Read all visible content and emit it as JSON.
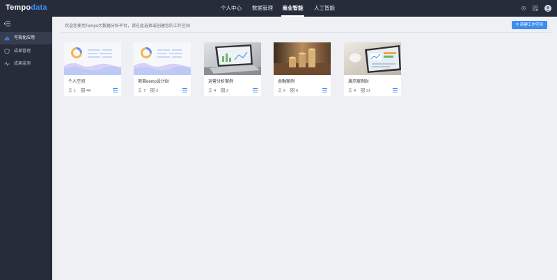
{
  "app": {
    "logo_part1": "Tempo",
    "logo_part2": "data",
    "brand_color": "#3d8cf0",
    "topbar_color": "#262c3a"
  },
  "nav": {
    "items": [
      {
        "label": "个人中心",
        "active": false
      },
      {
        "label": "数据管理",
        "active": false
      },
      {
        "label": "商业智能",
        "active": true
      },
      {
        "label": "人工智能",
        "active": false
      }
    ]
  },
  "header_icons": [
    "settings-icon",
    "qr-code-icon",
    "user-avatar"
  ],
  "sidebar": {
    "items": [
      {
        "label": "可视化应用",
        "icon": "bar-chart-icon",
        "active": true
      },
      {
        "label": "成果管理",
        "icon": "shield-icon",
        "active": false
      },
      {
        "label": "成果监测",
        "icon": "pulse-icon",
        "active": false
      }
    ]
  },
  "main": {
    "welcome": "欢迎您使用Tempo大数据分析平台，请在此选择或创建您的工作空间",
    "new_button": "新建工作空间",
    "cards": [
      {
        "title": "个人空间",
        "users": "1",
        "items": "44",
        "thumb": "chart-placeholder"
      },
      {
        "title": "项目demo设计BI",
        "users": "7",
        "items": "3",
        "thumb": "chart-placeholder"
      },
      {
        "title": "运营分析案例",
        "users": "4",
        "items": "2",
        "thumb": "laptop-photo"
      },
      {
        "title": "金融案例",
        "users": "6",
        "items": "9",
        "thumb": "coins-photo"
      },
      {
        "title": "演示案例BI",
        "users": "4",
        "items": "31",
        "thumb": "tablet-photo"
      }
    ]
  }
}
